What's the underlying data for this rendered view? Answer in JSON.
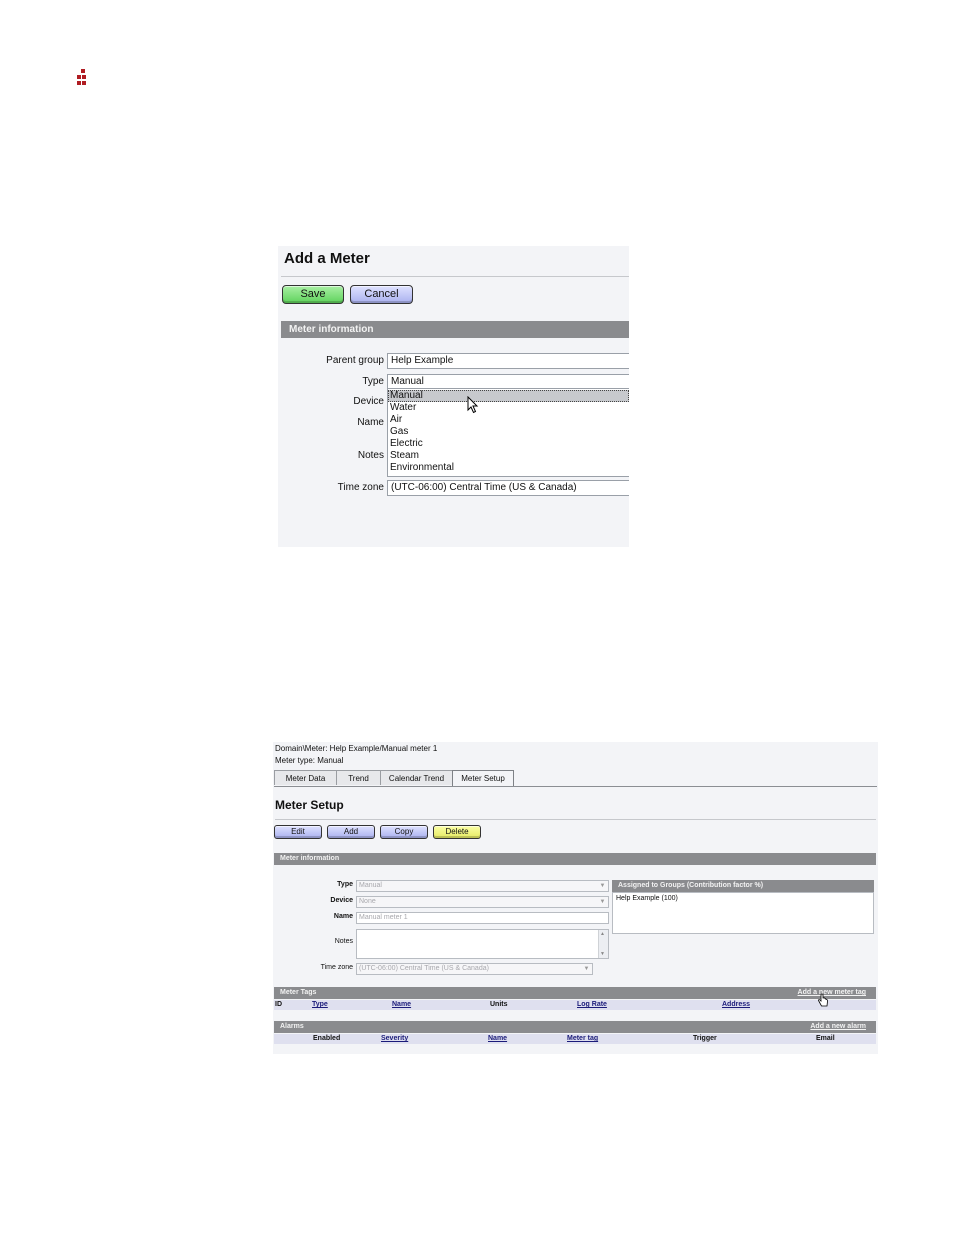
{
  "add_meter": {
    "title": "Add a Meter",
    "save_label": "Save",
    "cancel_label": "Cancel",
    "section_title": "Meter information",
    "labels": {
      "parent_group": "Parent group",
      "type": "Type",
      "device": "Device",
      "name": "Name",
      "notes": "Notes",
      "time_zone": "Time zone"
    },
    "parent_group_value": "Help Example",
    "type_value": "Manual",
    "type_options": [
      "Manual",
      "Water",
      "Air",
      "Gas",
      "Electric",
      "Steam",
      "Environmental"
    ],
    "highlighted_option": "Manual",
    "time_zone_value": "(UTC-06:00) Central Time (US & Canada)"
  },
  "meter_setup": {
    "breadcrumb": "Domain\\Meter: Help Example/Manual meter 1",
    "meter_type": "Meter type: Manual",
    "tabs": [
      "Meter Data",
      "Trend",
      "Calendar Trend",
      "Meter Setup"
    ],
    "active_tab": "Meter Setup",
    "title": "Meter Setup",
    "buttons": {
      "edit": "Edit",
      "add": "Add",
      "copy": "Copy",
      "delete": "Delete"
    },
    "section_title": "Meter information",
    "labels": {
      "type": "Type",
      "device": "Device",
      "name": "Name",
      "notes": "Notes",
      "time_zone": "Time zone"
    },
    "type_value": "Manual",
    "device_value": "None",
    "name_value": "Manual meter 1",
    "time_zone_value": "(UTC-06:00) Central Time (US & Canada)",
    "groups_header": "Assigned to Groups (Contribution factor %)",
    "groups_entry": "Help Example (100)",
    "meter_tags": {
      "title": "Meter Tags",
      "link": "Add a new meter tag",
      "columns": [
        "ID",
        "Type",
        "Name",
        "Units",
        "Log Rate",
        "Address"
      ]
    },
    "alarms": {
      "title": "Alarms",
      "link": "Add a new alarm",
      "columns": [
        "Enabled",
        "Severity",
        "Name",
        "Meter tag",
        "Trigger",
        "Email"
      ]
    }
  },
  "colors": {
    "logo": "#b01c22",
    "save_green": "#5fd25c",
    "button_blue": "#aab1ef",
    "delete_yellow": "#e6ea63",
    "section_gray": "#8a8b8e"
  }
}
